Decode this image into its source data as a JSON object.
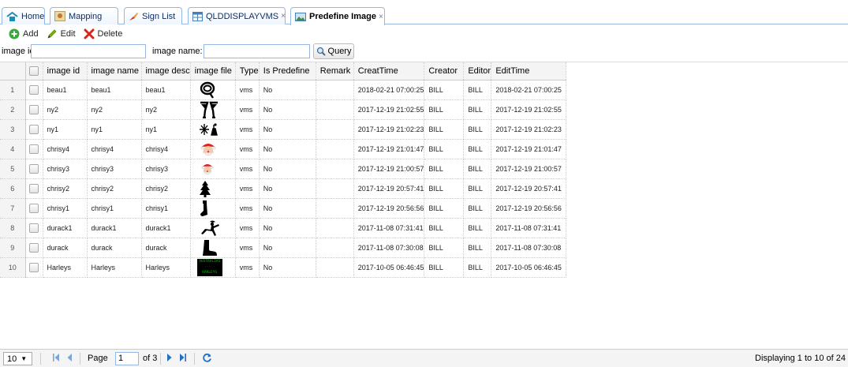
{
  "tabs": [
    {
      "label": "Home",
      "icon": "home-icon",
      "close": ""
    },
    {
      "label": "Mapping",
      "icon": "map-icon",
      "close": ""
    },
    {
      "label": "Sign List",
      "icon": "sign-icon",
      "close": ""
    },
    {
      "label": "QLDDISPLAYVMS",
      "icon": "table-icon",
      "close": "×"
    },
    {
      "label": "Predefine Image",
      "icon": "image-icon",
      "close": "×"
    }
  ],
  "toolbar": {
    "add_label": "Add",
    "edit_label": "Edit",
    "delete_label": "Delete"
  },
  "search": {
    "image_id_label": "image id:",
    "image_id_value": "",
    "image_name_label": "image name:",
    "image_name_value": "",
    "query_label": "Query"
  },
  "columns": [
    "image id",
    "image name",
    "image desc",
    "image file",
    "Type",
    "Is Predefine",
    "Remark",
    "CreatTime",
    "Creator",
    "Editor",
    "EditTime"
  ],
  "rows": [
    {
      "n": "1",
      "id": "beau1",
      "name": "beau1",
      "desc": "beau1",
      "icon": "lasso-icon",
      "type": "vms",
      "pre": "No",
      "remark": "",
      "ct": "2018-02-21 07:00:25",
      "creator": "BILL",
      "editor": "BILL",
      "et": "2018-02-21 07:00:25"
    },
    {
      "n": "2",
      "id": "ny2",
      "name": "ny2",
      "desc": "ny2",
      "icon": "glasses-icon",
      "type": "vms",
      "pre": "No",
      "remark": "",
      "ct": "2017-12-19 21:02:55",
      "creator": "BILL",
      "editor": "BILL",
      "et": "2017-12-19 21:02:55"
    },
    {
      "n": "3",
      "id": "ny1",
      "name": "ny1",
      "desc": "ny1",
      "icon": "fireworks-icon",
      "type": "vms",
      "pre": "No",
      "remark": "",
      "ct": "2017-12-19 21:02:23",
      "creator": "BILL",
      "editor": "BILL",
      "et": "2017-12-19 21:02:23"
    },
    {
      "n": "4",
      "id": "chrisy4",
      "name": "chrisy4",
      "desc": "chrisy4",
      "icon": "santa-icon",
      "type": "vms",
      "pre": "No",
      "remark": "",
      "ct": "2017-12-19 21:01:47",
      "creator": "BILL",
      "editor": "BILL",
      "et": "2017-12-19 21:01:47"
    },
    {
      "n": "5",
      "id": "chrisy3",
      "name": "chrisy3",
      "desc": "chrisy3",
      "icon": "santa-small-icon",
      "type": "vms",
      "pre": "No",
      "remark": "",
      "ct": "2017-12-19 21:00:57",
      "creator": "BILL",
      "editor": "BILL",
      "et": "2017-12-19 21:00:57"
    },
    {
      "n": "6",
      "id": "chrisy2",
      "name": "chrisy2",
      "desc": "chrisy2",
      "icon": "tree-icon",
      "type": "vms",
      "pre": "No",
      "remark": "",
      "ct": "2017-12-19 20:57:41",
      "creator": "BILL",
      "editor": "BILL",
      "et": "2017-12-19 20:57:41"
    },
    {
      "n": "7",
      "id": "chrisy1",
      "name": "chrisy1",
      "desc": "chrisy1",
      "icon": "stocking-icon",
      "type": "vms",
      "pre": "No",
      "remark": "",
      "ct": "2017-12-19 20:56:56",
      "creator": "BILL",
      "editor": "BILL",
      "et": "2017-12-19 20:56:56"
    },
    {
      "n": "8",
      "id": "durack1",
      "name": "durack1",
      "desc": "durack1",
      "icon": "cowgirl-icon",
      "type": "vms",
      "pre": "No",
      "remark": "",
      "ct": "2017-11-08 07:31:41",
      "creator": "BILL",
      "editor": "BILL",
      "et": "2017-11-08 07:31:41"
    },
    {
      "n": "9",
      "id": "durack",
      "name": "durack",
      "desc": "durack",
      "icon": "boot-icon",
      "type": "vms",
      "pre": "No",
      "remark": "",
      "ct": "2017-11-08 07:30:08",
      "creator": "BILL",
      "editor": "BILL",
      "et": "2017-11-08 07:30:08"
    },
    {
      "n": "10",
      "id": "Harleys",
      "name": "Harleys",
      "desc": "Harleys",
      "icon": "sign-thumbnail-icon",
      "type": "vms",
      "pre": "No",
      "remark": "",
      "ct": "2017-10-05 06:46:45",
      "creator": "BILL",
      "editor": "BILL",
      "et": "2017-10-05 06:46:45"
    }
  ],
  "thumb_text": [
    "AUSTRALIAS",
    "HARLEYS"
  ],
  "pager": {
    "page_size": "10",
    "page_label": "Page",
    "page_value": "1",
    "of_label": "of 3",
    "status": "Displaying 1 to 10 of 24 items"
  },
  "colors": {
    "border": "#95b8e7",
    "header_bg": "#f4f4f4",
    "add": "#3aa83a",
    "edit": "#7ab800",
    "delete": "#d9251c",
    "sign_bg": "#000000",
    "sign_text": "#00c000"
  }
}
